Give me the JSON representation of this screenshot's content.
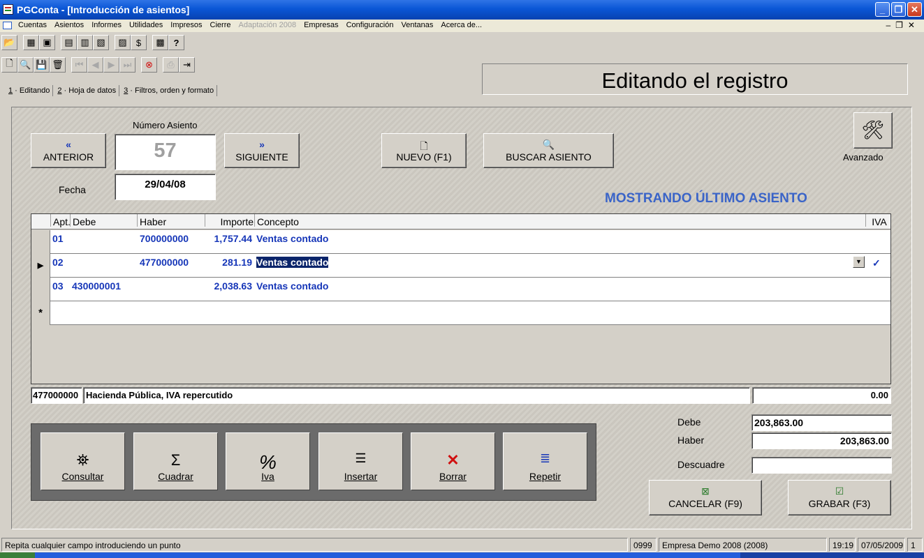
{
  "window": {
    "title": "PGConta - [Introducción de asientos]"
  },
  "menu": {
    "items": [
      "Cuentas",
      "Asientos",
      "Informes",
      "Utilidades",
      "Impresos",
      "Cierre",
      "Adaptación 2008",
      "Empresas",
      "Configuración",
      "Ventanas",
      "Acerca de..."
    ],
    "disabled_index": 6
  },
  "header": {
    "title": "Editando el registro"
  },
  "tabs": [
    {
      "key": "1",
      "label": " · Editando"
    },
    {
      "key": "2",
      "label": " · Hoja de datos"
    },
    {
      "key": "3",
      "label": " · Filtros, orden y formato"
    }
  ],
  "asiento": {
    "numero_label": "Número Asiento",
    "numero": "57",
    "fecha_label": "Fecha",
    "fecha": "29/04/08",
    "prev_label": "ANTERIOR",
    "next_label": "SIGUIENTE",
    "nuevo_label": "NUEVO (F1)",
    "buscar_label": "BUSCAR ASIENTO",
    "avanzado_label": "Avanzado",
    "status_msg": "MOSTRANDO ÚLTIMO ASIENTO"
  },
  "grid": {
    "columns": [
      "Apt.",
      "Debe",
      "Haber",
      "Importe",
      "Concepto",
      "IVA"
    ],
    "rows": [
      {
        "apt": "01",
        "debe": "",
        "haber": "700000000",
        "importe": "1,757.44",
        "concepto": "Ventas contado"
      },
      {
        "apt": "02",
        "debe": "",
        "haber": "477000000",
        "importe": "281.19",
        "concepto": "Ventas contado"
      },
      {
        "apt": "03",
        "debe": "430000001",
        "haber": "",
        "importe": "2,038.63",
        "concepto": "Ventas contado"
      }
    ],
    "new_row_marker": "*"
  },
  "cuenta": {
    "codigo": "477000000",
    "nombre": "Hacienda Pública, IVA repercutido",
    "saldo": "0.00"
  },
  "actions": [
    {
      "label": "Consultar",
      "icon": "binoculars-icon"
    },
    {
      "label": "Cuadrar",
      "icon": "sigma-icon"
    },
    {
      "label": "Iva",
      "icon": "percent-icon"
    },
    {
      "label": "Insertar",
      "icon": "insert-icon"
    },
    {
      "label": "Borrar",
      "icon": "delete-icon"
    },
    {
      "label": "Repetir",
      "icon": "repeat-icon"
    }
  ],
  "totals": {
    "debe_label": "Debe",
    "debe": "203,863.00",
    "haber_label": "Haber",
    "haber": "203,863.00",
    "descuadre_label": "Descuadre",
    "descuadre": ""
  },
  "footer_buttons": {
    "cancelar": "CANCELAR (F9)",
    "grabar": "GRABAR (F3)"
  },
  "statusbar": {
    "hint": "Repita cualquier campo introduciendo un punto",
    "code": "0999",
    "empresa": "Empresa Demo 2008 (2008)",
    "hora": "19:19",
    "fecha": "07/05/2009",
    "num": "1"
  }
}
